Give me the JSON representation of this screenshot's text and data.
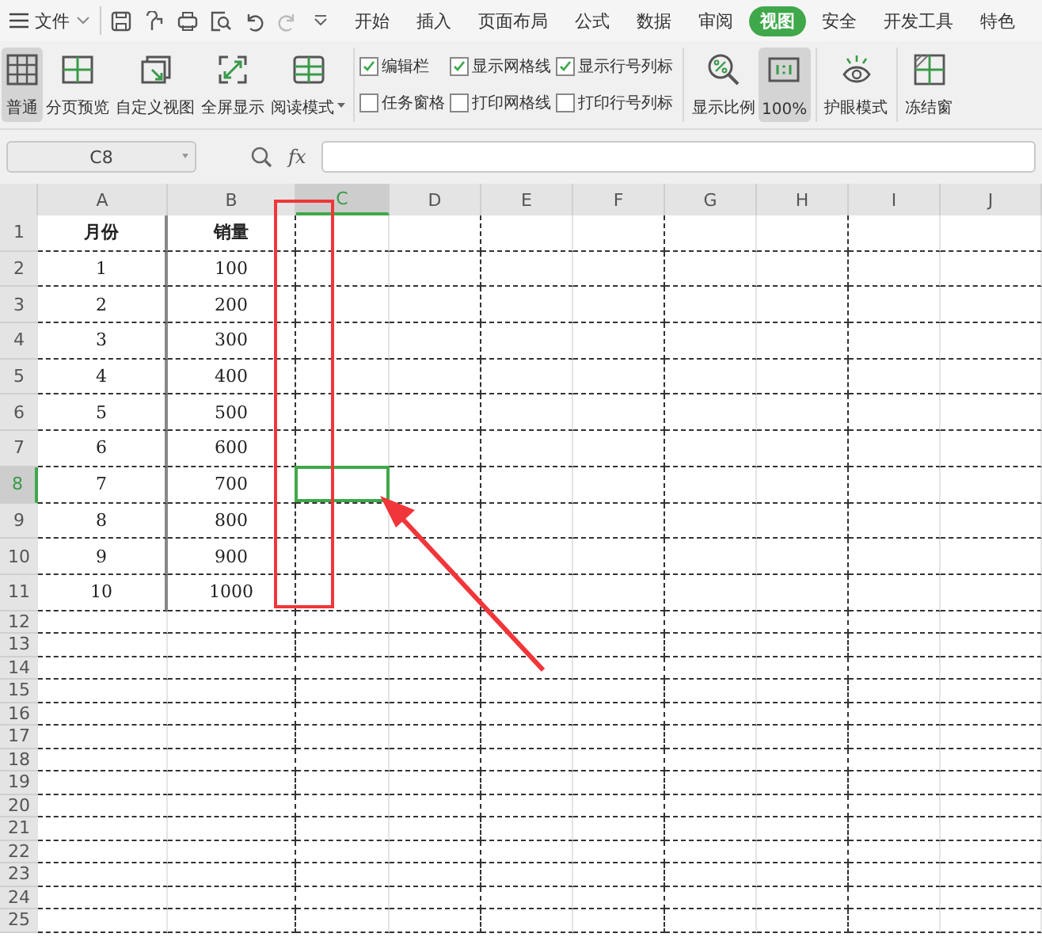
{
  "menu_bar": {
    "file_menu": "文件",
    "tabs": [
      {
        "label": "开始",
        "selected": false
      },
      {
        "label": "插入",
        "selected": false
      },
      {
        "label": "页面布局",
        "selected": false
      },
      {
        "label": "公式",
        "selected": false
      },
      {
        "label": "数据",
        "selected": false
      },
      {
        "label": "审阅",
        "selected": false
      },
      {
        "label": "视图",
        "selected": true
      },
      {
        "label": "安全",
        "selected": false
      },
      {
        "label": "开发工具",
        "selected": false
      },
      {
        "label": "特色",
        "selected": false
      }
    ]
  },
  "ribbon": {
    "view_buttons": [
      {
        "label": "普通",
        "kind": "normal",
        "selected": true
      },
      {
        "label": "分页预览",
        "kind": "page-break",
        "selected": false
      },
      {
        "label": "自定义视图",
        "kind": "custom",
        "selected": false
      },
      {
        "label": "全屏显示",
        "kind": "fullscreen",
        "selected": false
      },
      {
        "label": "阅读模式",
        "kind": "reading",
        "selected": false,
        "dropdown": true
      }
    ],
    "checkbox_columns": [
      [
        {
          "label": "编辑栏",
          "checked": true
        },
        {
          "label": "任务窗格",
          "checked": false
        }
      ],
      [
        {
          "label": "显示网格线",
          "checked": true
        },
        {
          "label": "打印网格线",
          "checked": false
        }
      ],
      [
        {
          "label": "显示行号列标",
          "checked": true
        },
        {
          "label": "打印行号列标",
          "checked": false
        }
      ]
    ],
    "zoom_buttons": [
      {
        "label": "显示比例",
        "kind": "zoom",
        "selected": false
      },
      {
        "label": "100%",
        "kind": "actual",
        "selected": true
      }
    ],
    "eye_mode": "护眼模式",
    "freeze": "冻结窗"
  },
  "formula_bar": {
    "name_box": "C8",
    "fx": "fx"
  },
  "sheet": {
    "columns": [
      {
        "label": "A",
        "selected": false,
        "page_break": false
      },
      {
        "label": "B",
        "selected": false,
        "page_break": true
      },
      {
        "label": "C",
        "selected": true,
        "page_break": false
      },
      {
        "label": "D",
        "selected": false,
        "page_break": true
      },
      {
        "label": "E",
        "selected": false,
        "page_break": false
      },
      {
        "label": "F",
        "selected": false,
        "page_break": true
      },
      {
        "label": "G",
        "selected": false,
        "page_break": false
      },
      {
        "label": "H",
        "selected": false,
        "page_break": true
      },
      {
        "label": "I",
        "selected": false,
        "page_break": false
      },
      {
        "label": "J",
        "selected": false,
        "page_break": false
      }
    ],
    "rows": [
      {
        "number": "1",
        "kind": "header",
        "selected": false,
        "cells": [
          "月份",
          "销量"
        ]
      },
      {
        "number": "2",
        "kind": "data",
        "selected": false,
        "cells": [
          "1",
          "100"
        ]
      },
      {
        "number": "3",
        "kind": "data",
        "selected": false,
        "cells": [
          "2",
          "200"
        ]
      },
      {
        "number": "4",
        "kind": "data",
        "selected": false,
        "cells": [
          "3",
          "300"
        ]
      },
      {
        "number": "5",
        "kind": "data",
        "selected": false,
        "cells": [
          "4",
          "400"
        ]
      },
      {
        "number": "6",
        "kind": "data",
        "selected": false,
        "cells": [
          "5",
          "500"
        ]
      },
      {
        "number": "7",
        "kind": "data",
        "selected": false,
        "cells": [
          "6",
          "600"
        ]
      },
      {
        "number": "8",
        "kind": "data",
        "selected": true,
        "cells": [
          "7",
          "700"
        ]
      },
      {
        "number": "9",
        "kind": "data",
        "selected": false,
        "cells": [
          "8",
          "800"
        ]
      },
      {
        "number": "10",
        "kind": "data",
        "selected": false,
        "cells": [
          "9",
          "900"
        ]
      },
      {
        "number": "11",
        "kind": "data",
        "selected": false,
        "cells": [
          "10",
          "1000"
        ]
      },
      {
        "number": "12",
        "kind": "blank",
        "selected": false
      },
      {
        "number": "13",
        "kind": "blank",
        "selected": false
      },
      {
        "number": "14",
        "kind": "blank",
        "selected": false
      },
      {
        "number": "15",
        "kind": "blank",
        "selected": false
      },
      {
        "number": "16",
        "kind": "blank",
        "selected": false
      },
      {
        "number": "17",
        "kind": "blank",
        "selected": false
      },
      {
        "number": "18",
        "kind": "blank",
        "selected": false
      },
      {
        "number": "19",
        "kind": "blank",
        "selected": false
      },
      {
        "number": "20",
        "kind": "blank",
        "selected": false
      },
      {
        "number": "21",
        "kind": "blank",
        "selected": false
      },
      {
        "number": "22",
        "kind": "blank",
        "selected": false
      },
      {
        "number": "23",
        "kind": "blank",
        "selected": false
      },
      {
        "number": "24",
        "kind": "blank",
        "selected": false
      },
      {
        "number": "25",
        "kind": "blank",
        "selected": false
      }
    ]
  }
}
